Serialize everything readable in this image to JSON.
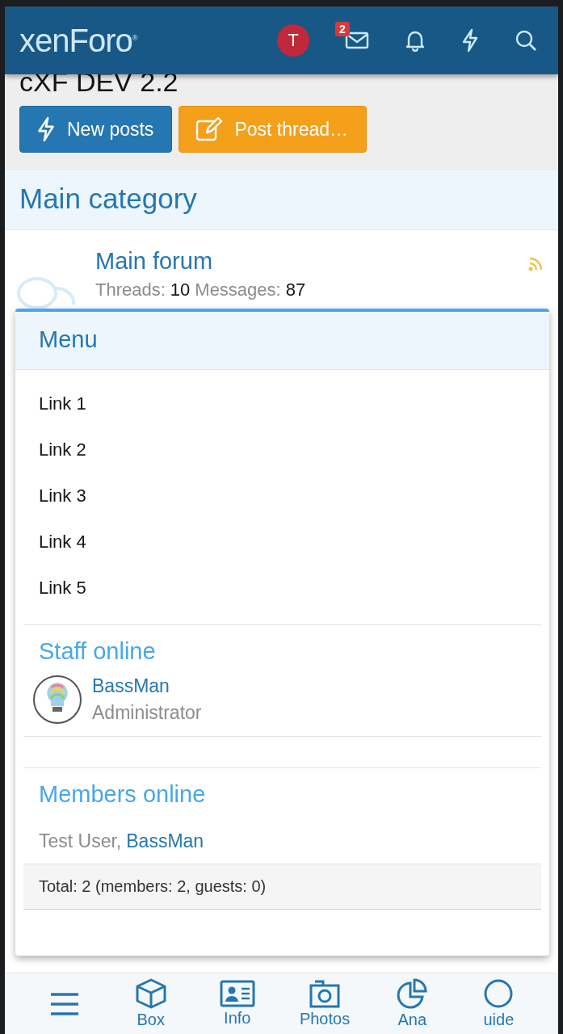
{
  "header": {
    "logo": "xenForo$^{®}$",
    "avatar_letter": "T",
    "inbox_badge": "2"
  },
  "page_title": "cXF DEV 2.2",
  "actions": [
    {
      "label": "New posts",
      "kind": "new"
    },
    {
      "label": "Post thread…",
      "kind": "post"
    }
  ],
  "category": {
    "title": "Main category",
    "forums": [
      {
        "title": "Main forum",
        "threads_label": "Threads:",
        "threads": "10",
        "messages_label": "Messages:",
        "messages": "87"
      }
    ]
  },
  "menu": {
    "title": "Menu",
    "links": [
      "Link 1",
      "Link 2",
      "Link 3",
      "Link 4",
      "Link 5"
    ],
    "staff_title": "Staff online",
    "staff": [
      {
        "name": "BassMan",
        "role": "Administrator"
      }
    ],
    "members_title": "Members online",
    "members": [
      {
        "name": "Test User,",
        "kind": "guest"
      },
      {
        "name": "BassMan",
        "kind": "link"
      }
    ],
    "total": "Total: 2 (members: 2, guests: 0)"
  },
  "bottom_nav": [
    {
      "kind": "menu"
    },
    {
      "label": "Box",
      "kind": "box"
    },
    {
      "label": "Info",
      "kind": "info"
    },
    {
      "label": "Photos",
      "kind": "photos"
    },
    {
      "label": "Ana",
      "kind": "chart"
    },
    {
      "label": "uide",
      "kind": "guide"
    }
  ]
}
